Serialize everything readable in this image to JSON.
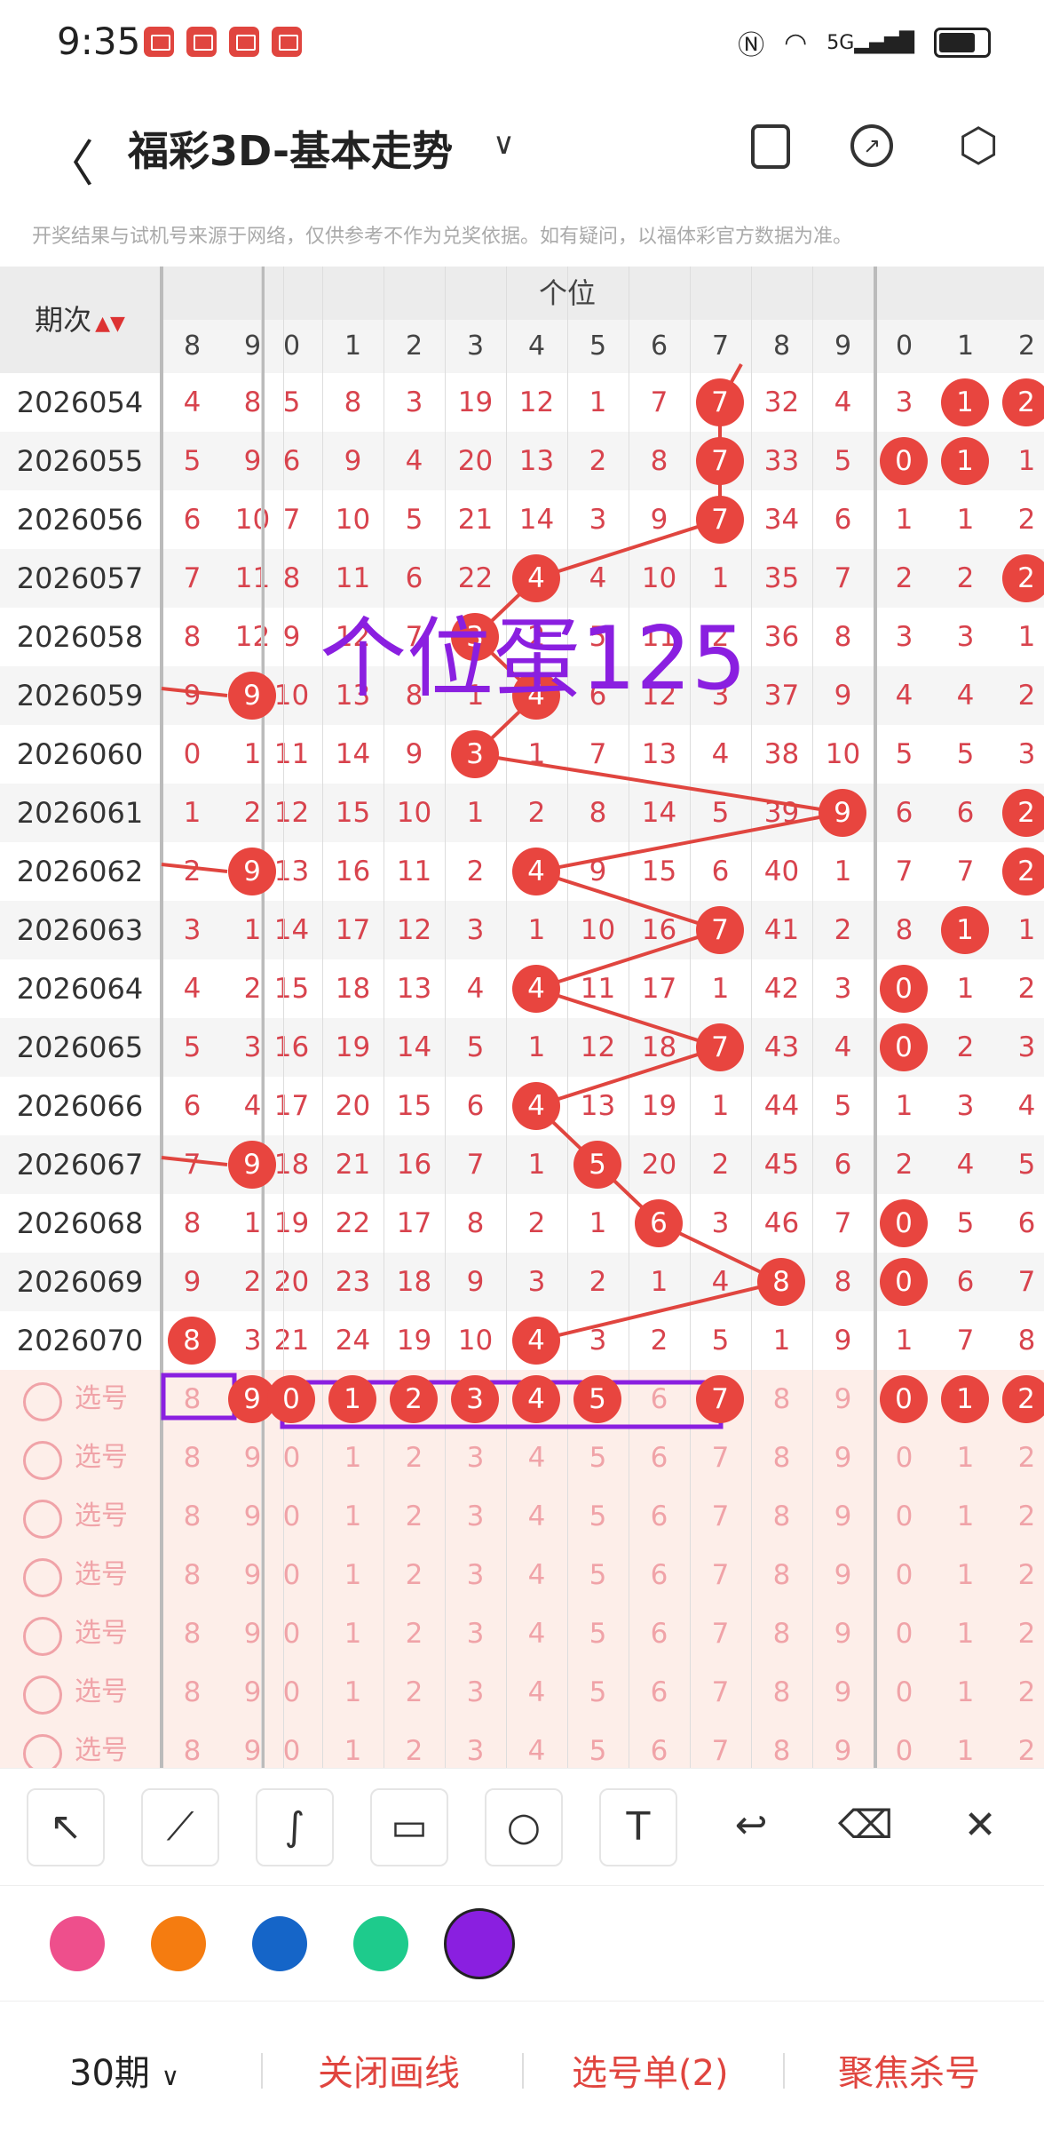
{
  "status_bar": {
    "time": "9:35",
    "network": "5G"
  },
  "header": {
    "title": "福彩3D-基本走势",
    "back_icon": "back-icon",
    "dropdown_icon": "chevron-down-icon"
  },
  "disclaimer": "开奖结果与试机号来源于网络，仅供参考不作为兑奖依据。如有疑问，以福体彩官方数据为准。",
  "table": {
    "period_header": "期次",
    "group_label": "个位",
    "left_digits": [
      "8",
      "9"
    ],
    "ge_digits": [
      "0",
      "1",
      "2",
      "3",
      "4",
      "5",
      "6",
      "7",
      "8",
      "9"
    ],
    "right_digits": [
      "0",
      "1",
      "2"
    ],
    "rows": [
      {
        "period": "2026054",
        "left": [
          "4",
          "8"
        ],
        "ge": [
          "5",
          "8",
          "3",
          "19",
          "12",
          "1",
          "7",
          "7",
          "32",
          "4"
        ],
        "right": [
          "3",
          "1",
          "2"
        ],
        "ball": 7,
        "right_balls": [
          1,
          2
        ]
      },
      {
        "period": "2026055",
        "left": [
          "5",
          "9"
        ],
        "ge": [
          "6",
          "9",
          "4",
          "20",
          "13",
          "2",
          "8",
          "7",
          "33",
          "5"
        ],
        "right": [
          "0",
          "1",
          "1"
        ],
        "ball": 7,
        "right_balls": [
          0,
          1
        ]
      },
      {
        "period": "2026056",
        "left": [
          "6",
          "10"
        ],
        "ge": [
          "7",
          "10",
          "5",
          "21",
          "14",
          "3",
          "9",
          "7",
          "34",
          "6"
        ],
        "right": [
          "1",
          "1",
          "2"
        ],
        "ball": 7,
        "right_balls": []
      },
      {
        "period": "2026057",
        "left": [
          "7",
          "11"
        ],
        "ge": [
          "8",
          "11",
          "6",
          "22",
          "4",
          "4",
          "10",
          "1",
          "35",
          "7"
        ],
        "right": [
          "2",
          "2",
          "2"
        ],
        "ball": 4,
        "right_balls": [
          2
        ]
      },
      {
        "period": "2026058",
        "left": [
          "8",
          "12"
        ],
        "ge": [
          "9",
          "12",
          "7",
          "3",
          "2",
          "5",
          "11",
          "2",
          "36",
          "8"
        ],
        "right": [
          "3",
          "3",
          "1"
        ],
        "ball": 3,
        "right_balls": []
      },
      {
        "period": "2026059",
        "left": [
          "9",
          "9"
        ],
        "ge": [
          "10",
          "13",
          "8",
          "1",
          "4",
          "6",
          "12",
          "3",
          "37",
          "9"
        ],
        "right": [
          "4",
          "4",
          "2"
        ],
        "ball": 4,
        "left_ball": 1,
        "right_balls": []
      },
      {
        "period": "2026060",
        "left": [
          "0",
          "1"
        ],
        "ge": [
          "11",
          "14",
          "9",
          "3",
          "1",
          "7",
          "13",
          "4",
          "38",
          "10"
        ],
        "right": [
          "5",
          "5",
          "3"
        ],
        "ball": 3,
        "right_balls": []
      },
      {
        "period": "2026061",
        "left": [
          "1",
          "2"
        ],
        "ge": [
          "12",
          "15",
          "10",
          "1",
          "2",
          "8",
          "14",
          "5",
          "39",
          "9"
        ],
        "right": [
          "6",
          "6",
          "2"
        ],
        "ball": 9,
        "right_balls": [
          2
        ]
      },
      {
        "period": "2026062",
        "left": [
          "2",
          "9"
        ],
        "ge": [
          "13",
          "16",
          "11",
          "2",
          "4",
          "9",
          "15",
          "6",
          "40",
          "1"
        ],
        "right": [
          "7",
          "7",
          "2"
        ],
        "ball": 4,
        "left_ball": 1,
        "right_balls": [
          2
        ]
      },
      {
        "period": "2026063",
        "left": [
          "3",
          "1"
        ],
        "ge": [
          "14",
          "17",
          "12",
          "3",
          "1",
          "10",
          "16",
          "7",
          "41",
          "2"
        ],
        "right": [
          "8",
          "1",
          "1"
        ],
        "ball": 7,
        "right_balls": [
          1
        ]
      },
      {
        "period": "2026064",
        "left": [
          "4",
          "2"
        ],
        "ge": [
          "15",
          "18",
          "13",
          "4",
          "4",
          "11",
          "17",
          "1",
          "42",
          "3"
        ],
        "right": [
          "0",
          "1",
          "2"
        ],
        "ball": 4,
        "right_balls": [
          0
        ]
      },
      {
        "period": "2026065",
        "left": [
          "5",
          "3"
        ],
        "ge": [
          "16",
          "19",
          "14",
          "5",
          "1",
          "12",
          "18",
          "7",
          "43",
          "4"
        ],
        "right": [
          "0",
          "2",
          "3"
        ],
        "ball": 7,
        "right_balls": [
          0
        ]
      },
      {
        "period": "2026066",
        "left": [
          "6",
          "4"
        ],
        "ge": [
          "17",
          "20",
          "15",
          "6",
          "4",
          "13",
          "19",
          "1",
          "44",
          "5"
        ],
        "right": [
          "1",
          "3",
          "4"
        ],
        "ball": 4,
        "right_balls": []
      },
      {
        "period": "2026067",
        "left": [
          "7",
          "9"
        ],
        "ge": [
          "18",
          "21",
          "16",
          "7",
          "1",
          "5",
          "20",
          "2",
          "45",
          "6"
        ],
        "right": [
          "2",
          "4",
          "5"
        ],
        "ball": 5,
        "left_ball": 1,
        "right_balls": []
      },
      {
        "period": "2026068",
        "left": [
          "8",
          "1"
        ],
        "ge": [
          "19",
          "22",
          "17",
          "8",
          "2",
          "1",
          "6",
          "3",
          "46",
          "7"
        ],
        "right": [
          "0",
          "5",
          "6"
        ],
        "ball": 6,
        "right_balls": [
          0
        ]
      },
      {
        "period": "2026069",
        "left": [
          "9",
          "2"
        ],
        "ge": [
          "20",
          "23",
          "18",
          "9",
          "3",
          "2",
          "1",
          "4",
          "8",
          "8"
        ],
        "right": [
          "0",
          "6",
          "7"
        ],
        "ball": 8,
        "right_balls": [
          0
        ]
      },
      {
        "period": "2026070",
        "left": [
          "8",
          "3"
        ],
        "ge": [
          "21",
          "24",
          "19",
          "10",
          "4",
          "3",
          "2",
          "5",
          "1",
          "9"
        ],
        "right": [
          "1",
          "7",
          "8"
        ],
        "ball": 4,
        "left_ball": 0,
        "right_balls": []
      }
    ],
    "select_label": "选号",
    "select_rows": 7,
    "annotation": "个位蛋125"
  },
  "tools": [
    "arrow-tool",
    "line-tool",
    "curve-tool",
    "rect-tool",
    "circle-tool",
    "text-tool",
    "undo-tool",
    "eraser-tool",
    "clear-tool"
  ],
  "colors": [
    "#ee4f8c",
    "#f57c10",
    "#1565c8",
    "#1ecb8c",
    "#8a1fe0"
  ],
  "active_color": "#8a1fe0",
  "bottom": {
    "periods": "30期",
    "close_draw": "关闭画线",
    "selection": "选号单(2)",
    "focus": "聚焦杀号"
  }
}
